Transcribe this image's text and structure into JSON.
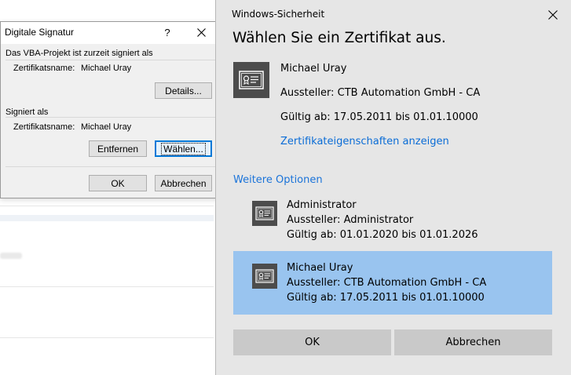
{
  "signature_dialog": {
    "title": "Digitale Signatur",
    "help": "?",
    "current_section_label": "Das VBA-Projekt ist zurzeit signiert als",
    "current_cert_label": "Zertifikatsname:",
    "current_cert_name": "Michael Uray",
    "details_button": "Details...",
    "signed_as_label": "Signiert als",
    "signed_cert_label": "Zertifikatsname:",
    "signed_cert_name": "Michael Uray",
    "remove_button": "Entfernen",
    "choose_button": "Wählen...",
    "ok_button": "OK",
    "cancel_button": "Abbrechen"
  },
  "security_dialog": {
    "caption": "Windows-Sicherheit",
    "heading": "Wählen Sie ein Zertifikat aus.",
    "primary_cert": {
      "name": "Michael Uray",
      "issuer": "Aussteller: CTB Automation GmbH - CA",
      "validity": "Gültig ab: 17.05.2011 bis 01.01.10000"
    },
    "properties_link": "Zertifikateigenschaften anzeigen",
    "more_options": "Weitere Optionen",
    "options": [
      {
        "name": "Administrator",
        "issuer": "Aussteller: Administrator",
        "validity": "Gültig ab: 01.01.2020 bis 01.01.2026",
        "selected": false
      },
      {
        "name": "Michael Uray",
        "issuer": "Aussteller: CTB Automation GmbH - CA",
        "validity": "Gültig ab: 17.05.2011 bis 01.01.10000",
        "selected": true
      }
    ],
    "ok_button": "OK",
    "cancel_button": "Abbrechen"
  },
  "colors": {
    "selected_option": "#99c4ef",
    "link": "#0a6cd6",
    "button": "#c9c9c9",
    "dialog_bg": "#e6e6e6"
  },
  "icons": [
    "close-icon",
    "certificate-icon"
  ]
}
